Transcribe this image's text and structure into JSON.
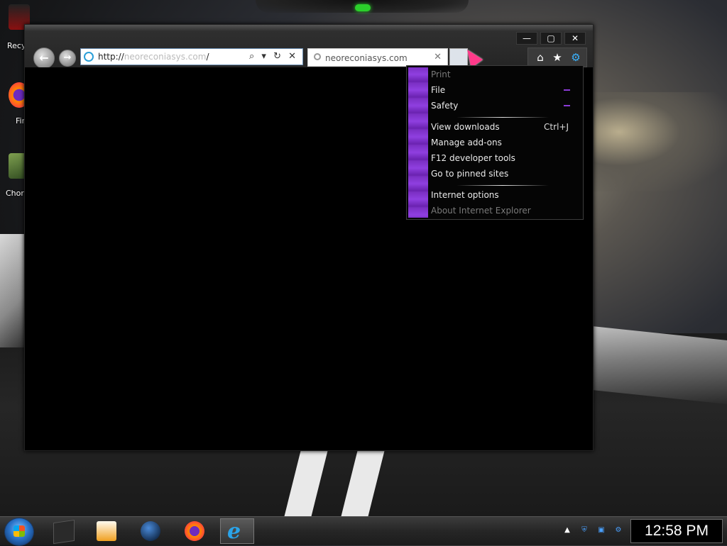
{
  "desktop": {
    "icons": [
      {
        "label": "Recy"
      },
      {
        "label": "Fir"
      },
      {
        "label": "Chor"
      }
    ]
  },
  "browser": {
    "window_controls": {
      "minimize": "—",
      "maximize": "▢",
      "close": "✕"
    },
    "address": {
      "prefix": "http://",
      "host": "neoreconiasys.com",
      "suffix": "/"
    },
    "address_tools": "⌕ ▾ ↻ ✕",
    "tab": {
      "title": "neoreconiasys.com",
      "close": "✕"
    },
    "toolbar": {
      "home_icon": "home-icon",
      "favorites_icon": "star-icon",
      "tools_icon": "gear-icon"
    }
  },
  "tools_menu": {
    "items": [
      {
        "label": "Print",
        "disabled": true
      },
      {
        "label": "File",
        "submenu": true
      },
      {
        "label": "Safety",
        "submenu": true
      },
      {
        "label": "View downloads",
        "shortcut": "Ctrl+J"
      },
      {
        "label": "Manage add-ons"
      },
      {
        "label": "F12 developer tools"
      },
      {
        "label": "Go to pinned sites"
      },
      {
        "label": "Internet options"
      },
      {
        "label": "About Internet Explorer",
        "disabled": true
      }
    ],
    "accent_color": "#8b3bd6"
  },
  "taskbar": {
    "apps": [
      "file-explorer",
      "media-player",
      "globe-app",
      "firefox",
      "internet-explorer"
    ],
    "active_app": "internet-explorer",
    "clock": "12:58 PM"
  }
}
